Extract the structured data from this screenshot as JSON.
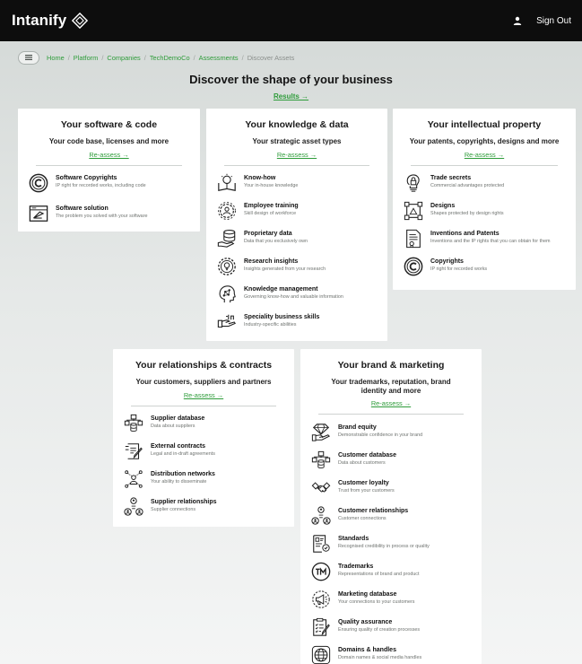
{
  "app": {
    "brand": "Intanify",
    "sign_out": "Sign Out"
  },
  "breadcrumb": {
    "items": [
      "Home",
      "Platform",
      "Companies",
      "TechDemoCo",
      "Assessments"
    ],
    "current": "Discover Assets",
    "separator": "/"
  },
  "page": {
    "title": "Discover the shape of your business",
    "results_link": "Results →"
  },
  "colors": {
    "accent_green": "#2e9c3a",
    "topbar": "#0d0d0d"
  },
  "cards": {
    "software": {
      "title": "Your software & code",
      "subtitle": "Your code base, licenses and more",
      "reassess": "Re-assess →",
      "items": [
        {
          "name": "Software Copyrights",
          "desc": "IP right for recorded works, including code",
          "icon": "copyright-icon"
        },
        {
          "name": "Software solution",
          "desc": "The problem you solved with your software",
          "icon": "software-window-icon"
        }
      ]
    },
    "knowledge": {
      "title": "Your knowledge & data",
      "subtitle": "Your strategic asset types",
      "reassess": "Re-assess →",
      "items": [
        {
          "name": "Know-how",
          "desc": "Your in-house knowledge",
          "icon": "book-lightbulb-icon"
        },
        {
          "name": "Employee training",
          "desc": "Skill design of workforce",
          "icon": "gear-person-icon"
        },
        {
          "name": "Proprietary data",
          "desc": "Data that you exclusively own",
          "icon": "database-hand-icon"
        },
        {
          "name": "Research insights",
          "desc": "Insights generated from your research",
          "icon": "gear-bulb-icon"
        },
        {
          "name": "Knowledge management",
          "desc": "Governing know-how and valuable information",
          "icon": "head-network-icon"
        },
        {
          "name": "Speciality business skills",
          "desc": "Industry-specific abilities",
          "icon": "hand-tools-icon"
        }
      ]
    },
    "ip": {
      "title": "Your intellectual property",
      "subtitle": "Your patents, copyrights, designs and more",
      "reassess": "Re-assess →",
      "items": [
        {
          "name": "Trade secrets",
          "desc": "Commercial advantages protected",
          "icon": "bulb-lock-icon"
        },
        {
          "name": "Designs",
          "desc": "Shapes protected by design rights",
          "icon": "design-icon"
        },
        {
          "name": "Inventions and Patents",
          "desc": "Inventions and the IP rights that you can obtain for them",
          "icon": "patent-document-icon"
        },
        {
          "name": "Copyrights",
          "desc": "IP right for recorded works",
          "icon": "copyright-icon"
        }
      ]
    },
    "relationships": {
      "title": "Your relationships & contracts",
      "subtitle": "Your customers, suppliers and partners",
      "reassess": "Re-assess →",
      "items": [
        {
          "name": "Supplier database",
          "desc": "Data about suppliers",
          "icon": "org-database-icon"
        },
        {
          "name": "External contracts",
          "desc": "Legal and in-draft agreements",
          "icon": "contract-pen-icon"
        },
        {
          "name": "Distribution networks",
          "desc": "Your ability to disseminate",
          "icon": "distribution-icon"
        },
        {
          "name": "Supplier relationships",
          "desc": "Supplier connections",
          "icon": "people-connect-icon"
        }
      ]
    },
    "brand": {
      "title": "Your brand & marketing",
      "subtitle": "Your trademarks, reputation, brand identity and more",
      "reassess": "Re-assess →",
      "items": [
        {
          "name": "Brand equity",
          "desc": "Demonstrable confidence in your brand",
          "icon": "diamond-hand-icon"
        },
        {
          "name": "Customer database",
          "desc": "Data about customers",
          "icon": "org-database-icon"
        },
        {
          "name": "Customer loyalty",
          "desc": "Trust from your customers",
          "icon": "handshake-icon"
        },
        {
          "name": "Customer relationships",
          "desc": "Customer connections",
          "icon": "people-connect-icon"
        },
        {
          "name": "Standards",
          "desc": "Recognised credibility in process or quality",
          "icon": "standards-icon"
        },
        {
          "name": "Trademarks",
          "desc": "Representations of brand and product",
          "icon": "trademark-icon"
        },
        {
          "name": "Marketing database",
          "desc": "Your connections to your customers",
          "icon": "megaphone-icon"
        },
        {
          "name": "Quality assurance",
          "desc": "Ensuring quality of creation processes",
          "icon": "checklist-icon"
        },
        {
          "name": "Domains & handles",
          "desc": "Domain names & social media handles",
          "icon": "globe-icon"
        }
      ]
    }
  }
}
